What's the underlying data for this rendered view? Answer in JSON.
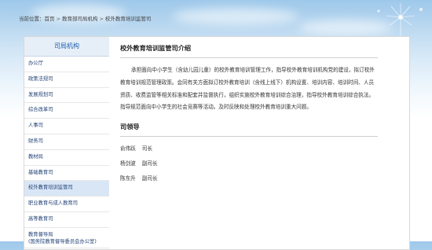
{
  "breadcrumb": {
    "prefix": "当前位置：",
    "items": [
      "首页",
      "教育部司局机构",
      "校外教育培训监管司"
    ],
    "separator": ">"
  },
  "sidebar": {
    "title": "司局机构",
    "items": [
      {
        "label": "办公厅"
      },
      {
        "label": "政策法规司"
      },
      {
        "label": "发展规划司"
      },
      {
        "label": "综合改革司"
      },
      {
        "label": "人事司"
      },
      {
        "label": "财务司"
      },
      {
        "label": "教材局"
      },
      {
        "label": "基础教育司"
      },
      {
        "label": "校外教育培训监管司",
        "active": true
      },
      {
        "label": "职业教育与成人教育司"
      },
      {
        "label": "高等教育司"
      },
      {
        "label": "教育督导局",
        "sublabel": "(国务院教育督导委员会办公室)"
      }
    ]
  },
  "content": {
    "title": "校外教育培训监管司介绍",
    "body": "承担面向中小学生（含幼儿园儿童）的校外教育培训管理工作，指导校外教育培训机构党的建设，拟订校外教育培训规范管理政策。会同有关方面拟订校外教育培训（含线上线下）机构设置、培训内容、培训时间、人员资质、收费监管等相关标准和配套并监督执行，组织实施校外教育培训综合治理，指导校外教育培训综合执法。指导规范面向中小学生的社会竞赛等活动。及时反映和处理校外教育培训重大问题。",
    "leaders_title": "司领导",
    "leaders": [
      {
        "name": "俞伟跃",
        "role": "司长"
      },
      {
        "name": "杨剑波",
        "role": "副司长"
      },
      {
        "name": "陈东升",
        "role": "副司长"
      }
    ]
  },
  "colors": {
    "sidebar_header_bg": "#e6eef8",
    "sidebar_title": "#1b5fab",
    "active_item_bg": "#d9e6f6",
    "link": "#1f3f73"
  },
  "icons": [
    "dandelion-decoration"
  ]
}
